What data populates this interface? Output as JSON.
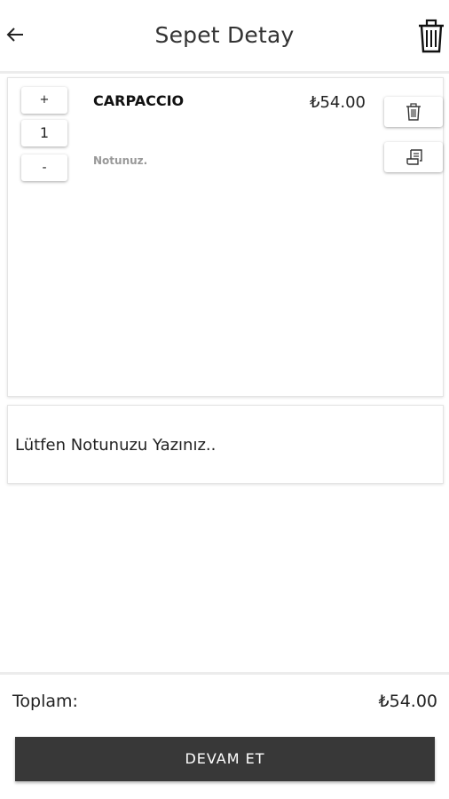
{
  "header": {
    "title": "Sepet Detay",
    "back_icon": "arrow-left-icon",
    "clear_icon": "trash-icon"
  },
  "cart": {
    "items": [
      {
        "name": "CARPACCIO",
        "price": "₺54.00",
        "quantity": "1",
        "increment_label": "+",
        "decrement_label": "-",
        "note": "Notunuz.",
        "delete_icon": "trash-icon",
        "note_icon": "receipt-icon"
      }
    ]
  },
  "note_input": {
    "placeholder": "Lütfen Notunuzu Yazınız.."
  },
  "footer": {
    "total_label": "Toplam:",
    "total_value": "₺54.00",
    "continue_label": "DEVAM ET"
  },
  "colors": {
    "button_bg": "#383838",
    "divider": "#ececec",
    "note_text": "#999999"
  }
}
